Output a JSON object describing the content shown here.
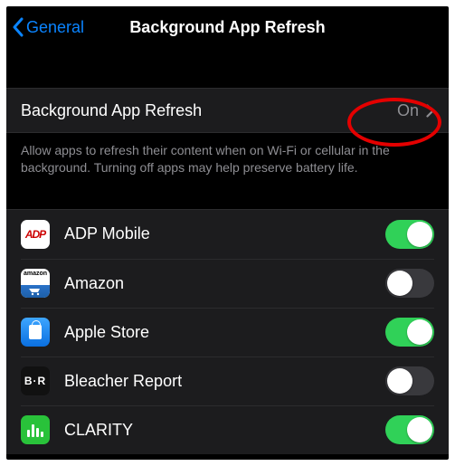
{
  "nav": {
    "back_label": "General",
    "title": "Background App Refresh"
  },
  "main_row": {
    "label": "Background App Refresh",
    "value": "On"
  },
  "footer": "Allow apps to refresh their content when on Wi-Fi or cellular in the background. Turning off apps may help preserve battery life.",
  "apps": {
    "0": {
      "name": "ADP Mobile",
      "enabled": "true"
    },
    "1": {
      "name": "Amazon",
      "enabled": "false"
    },
    "2": {
      "name": "Apple Store",
      "enabled": "true"
    },
    "3": {
      "name": "Bleacher Report",
      "enabled": "false"
    },
    "4": {
      "name": "CLARITY",
      "enabled": "true"
    }
  },
  "annotation": {
    "color": "#e40000"
  }
}
